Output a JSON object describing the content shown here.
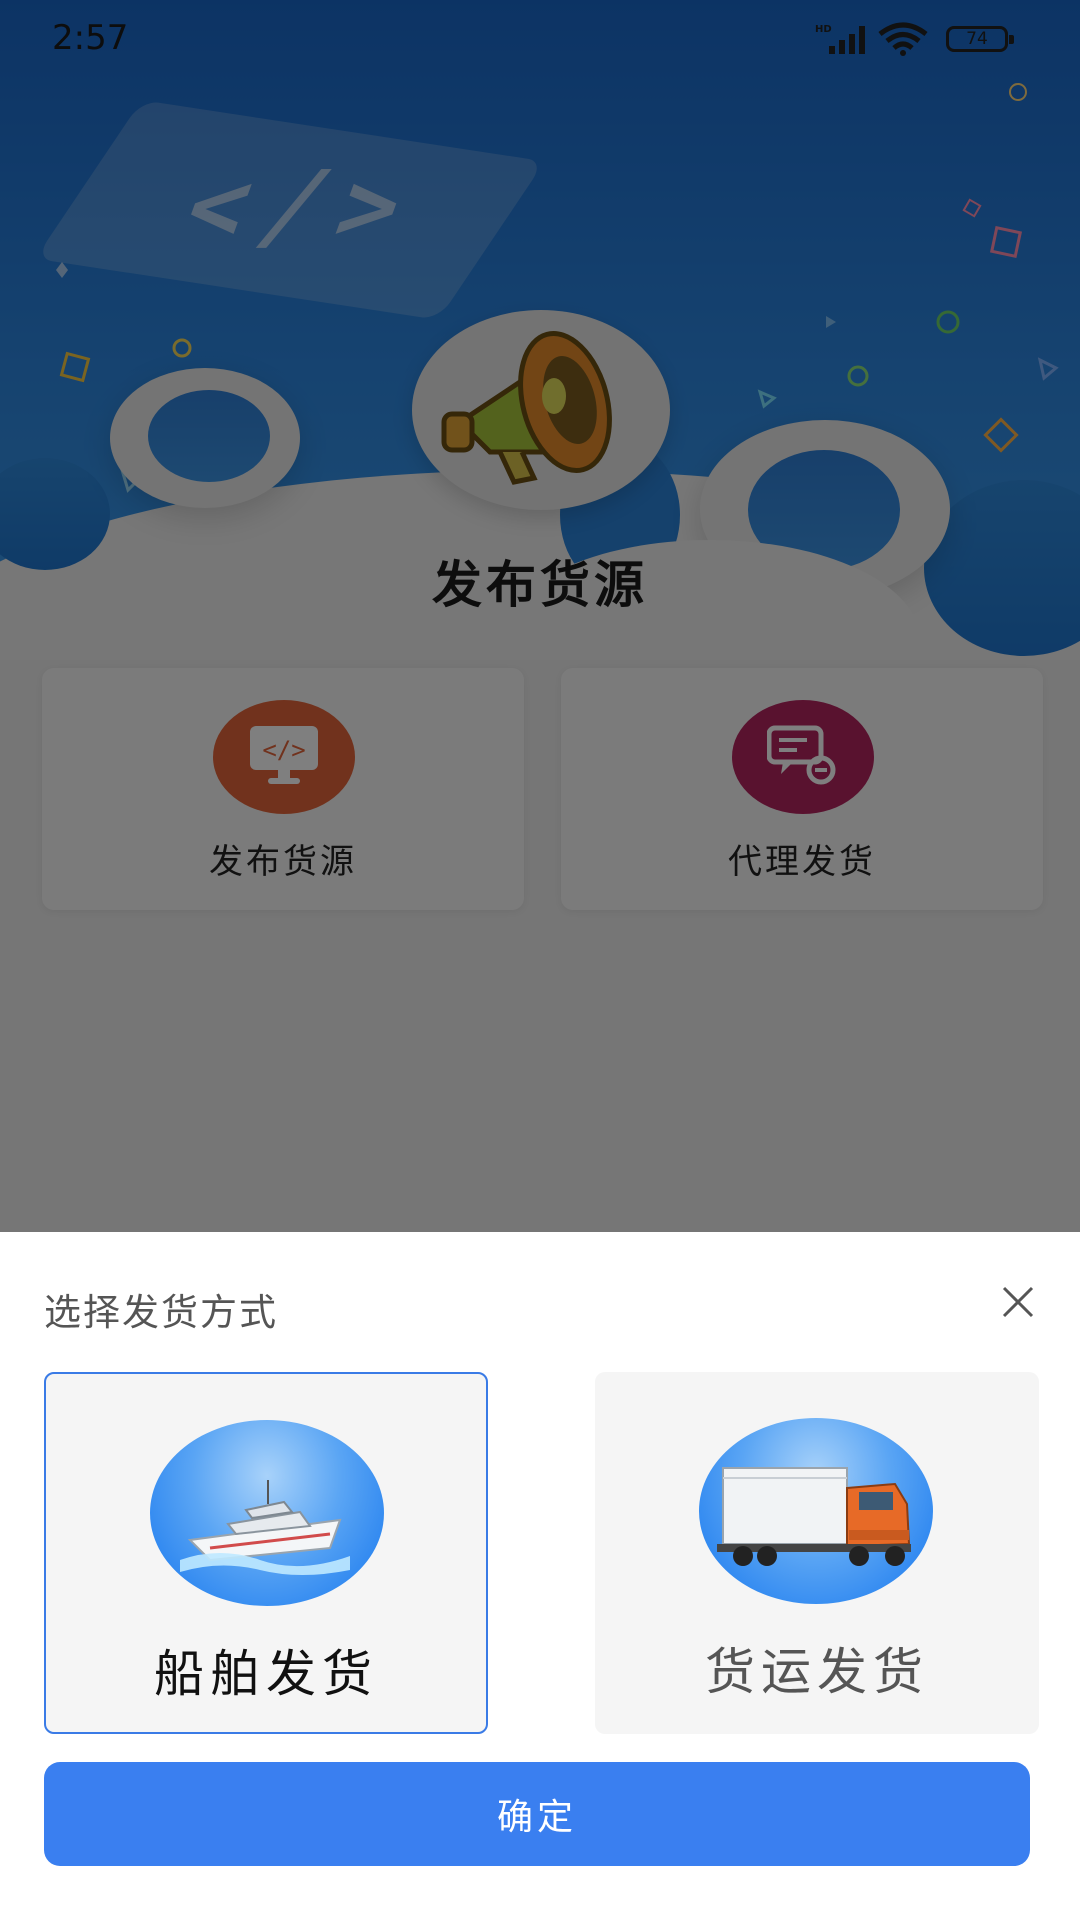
{
  "status_bar": {
    "time": "2:57",
    "battery": "74",
    "network_label": "HD"
  },
  "hero": {
    "title": "发布货源"
  },
  "cards": [
    {
      "label": "发布货源",
      "icon": "code-monitor-icon",
      "color": "#c4502a"
    },
    {
      "label": "代理发货",
      "icon": "chat-bubbles-icon",
      "color": "#7f1a44"
    }
  ],
  "sheet": {
    "title": "选择发货方式",
    "options": [
      {
        "label": "船舶发货",
        "image": "ship-image",
        "selected": true
      },
      {
        "label": "货运发货",
        "image": "truck-image",
        "selected": false
      }
    ],
    "confirm_label": "确定"
  },
  "colors": {
    "accent": "#3a7ff0",
    "hero_blue": "#2c86e0",
    "selected_border": "#3a7be6"
  }
}
